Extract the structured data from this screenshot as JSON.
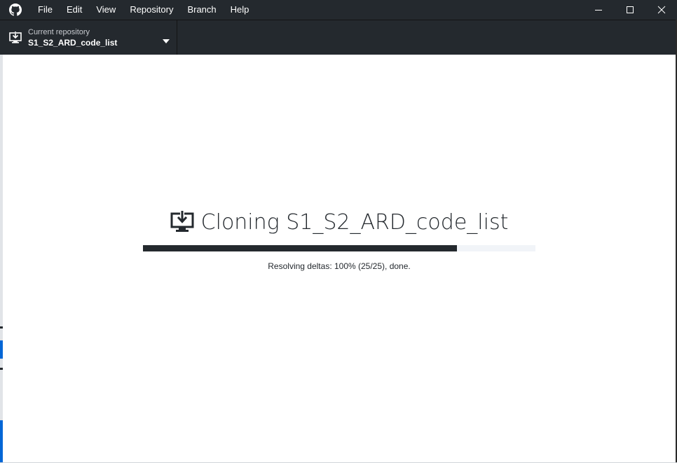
{
  "menubar": {
    "items": [
      "File",
      "Edit",
      "View",
      "Repository",
      "Branch",
      "Help"
    ]
  },
  "toolbar": {
    "repository": {
      "label": "Current repository",
      "name": "S1_S2_ARD_code_list"
    }
  },
  "clone": {
    "title": "Cloning S1_S2_ARD_code_list",
    "progress": 0.8,
    "status": "Resolving deltas: 100% (25/25), done."
  },
  "colors": {
    "chrome": "#24292e",
    "progress_track": "#f1f4f8",
    "accent": "#0366d6"
  },
  "icons": {
    "app": "github-octocat-icon",
    "repo": "clone-download-icon",
    "caret": "caret-down-icon"
  }
}
